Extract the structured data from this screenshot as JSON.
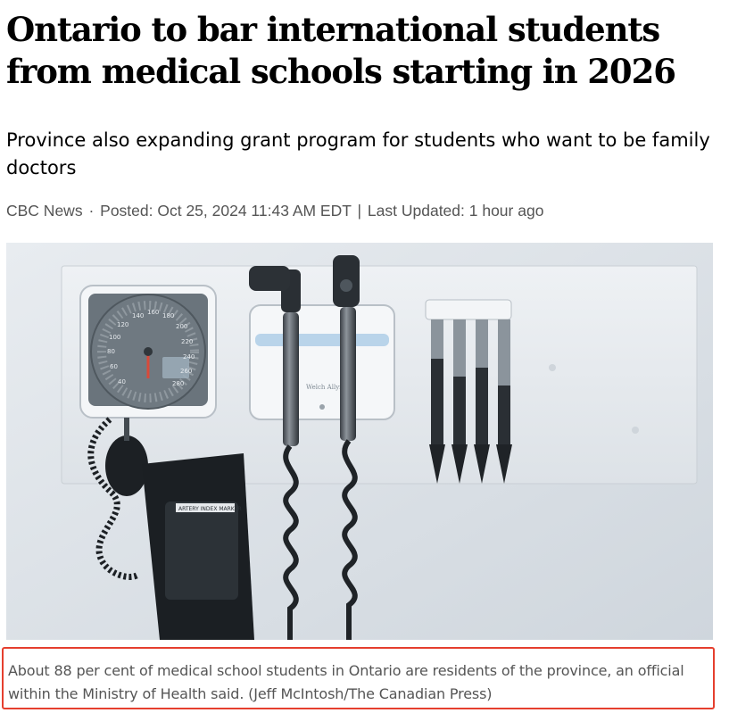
{
  "article": {
    "headline": "Ontario to bar international students from medical schools starting in 2026",
    "subheadline": "Province also expanding grant program for students who want to be family doctors",
    "byline": {
      "source": "CBC News",
      "separator": "·",
      "posted": "Posted: Oct 25, 2024 11:43 AM EDT",
      "divider": "|",
      "updated": "Last Updated: 1 hour ago"
    }
  },
  "image": {
    "brand_text": "Welch Allyn",
    "cuff_text": "ARTERY INDEX MARKER",
    "gauge_numbers": [
      "40",
      "60",
      "80",
      "100",
      "120",
      "140",
      "160",
      "180",
      "200",
      "220",
      "240",
      "260",
      "280"
    ]
  },
  "caption": {
    "text": "About 88 per cent of medical school students in Ontario are residents of the province, an official within the Ministry of Health said. (Jeff McIntosh/The Canadian Press)",
    "highlight_color": "#e53f2e"
  }
}
